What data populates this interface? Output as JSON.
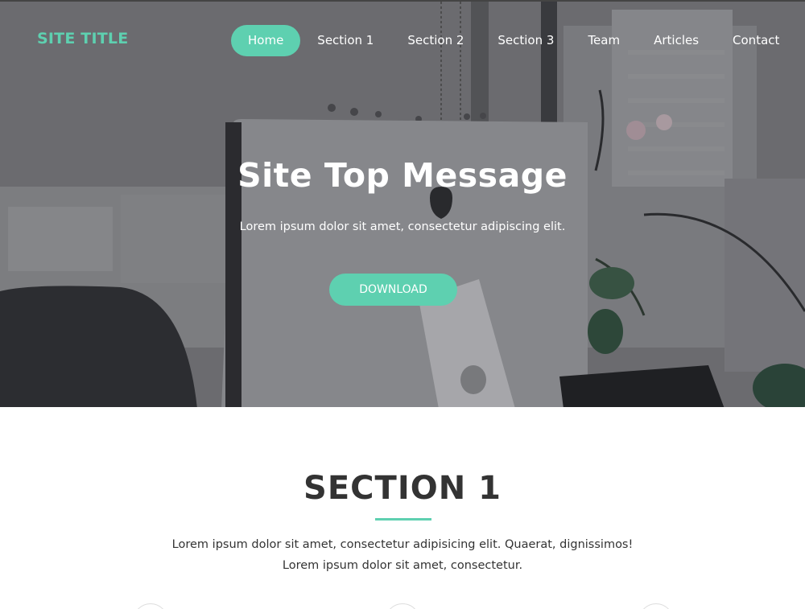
{
  "header": {
    "site_title": "SITE TITLE",
    "nav": [
      {
        "label": "Home",
        "active": true
      },
      {
        "label": "Section 1"
      },
      {
        "label": "Section 2"
      },
      {
        "label": "Section 3"
      },
      {
        "label": "Team"
      },
      {
        "label": "Articles"
      },
      {
        "label": "Contact"
      }
    ]
  },
  "hero": {
    "title": "Site Top Message",
    "subtitle": "Lorem ipsum dolor sit amet, consectetur adipiscing elit.",
    "cta_label": "DOWNLOAD"
  },
  "section1": {
    "title": "SECTION 1",
    "text_line1": "Lorem ipsum dolor sit amet, consectetur adipisicing elit. Quaerat, dignissimos!",
    "text_line2": "Lorem ipsum dolor sit amet, consectetur."
  },
  "colors": {
    "accent": "#5ed0b0",
    "heading": "#333333",
    "hero_text": "#ffffff"
  }
}
